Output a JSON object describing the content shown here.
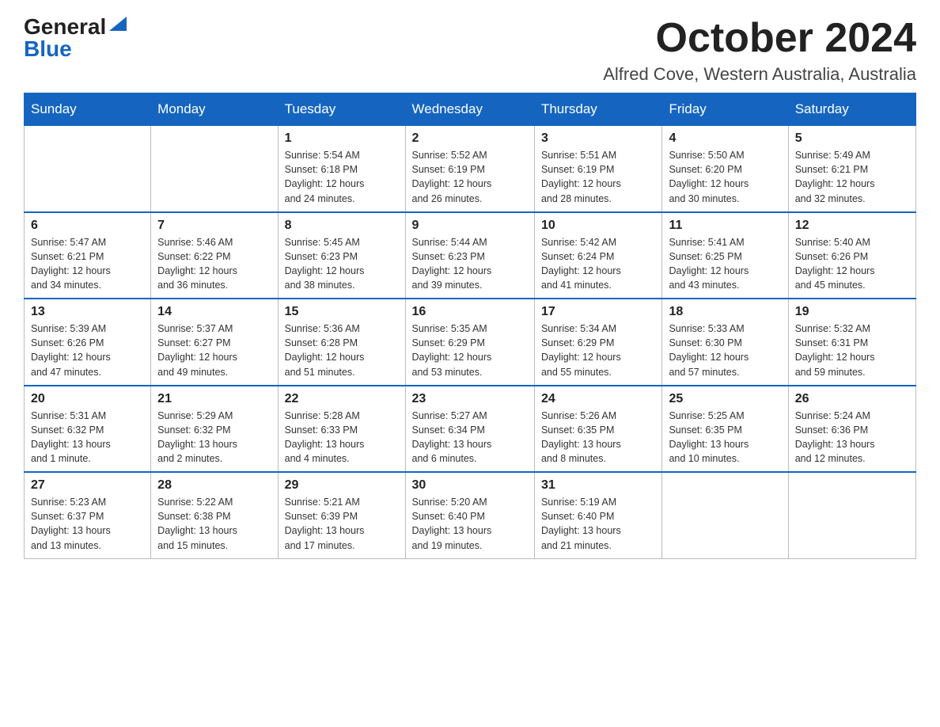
{
  "logo": {
    "general": "General",
    "blue": "Blue"
  },
  "title": "October 2024",
  "location": "Alfred Cove, Western Australia, Australia",
  "days_of_week": [
    "Sunday",
    "Monday",
    "Tuesday",
    "Wednesday",
    "Thursday",
    "Friday",
    "Saturday"
  ],
  "weeks": [
    [
      {
        "day": "",
        "info": ""
      },
      {
        "day": "",
        "info": ""
      },
      {
        "day": "1",
        "info": "Sunrise: 5:54 AM\nSunset: 6:18 PM\nDaylight: 12 hours\nand 24 minutes."
      },
      {
        "day": "2",
        "info": "Sunrise: 5:52 AM\nSunset: 6:19 PM\nDaylight: 12 hours\nand 26 minutes."
      },
      {
        "day": "3",
        "info": "Sunrise: 5:51 AM\nSunset: 6:19 PM\nDaylight: 12 hours\nand 28 minutes."
      },
      {
        "day": "4",
        "info": "Sunrise: 5:50 AM\nSunset: 6:20 PM\nDaylight: 12 hours\nand 30 minutes."
      },
      {
        "day": "5",
        "info": "Sunrise: 5:49 AM\nSunset: 6:21 PM\nDaylight: 12 hours\nand 32 minutes."
      }
    ],
    [
      {
        "day": "6",
        "info": "Sunrise: 5:47 AM\nSunset: 6:21 PM\nDaylight: 12 hours\nand 34 minutes."
      },
      {
        "day": "7",
        "info": "Sunrise: 5:46 AM\nSunset: 6:22 PM\nDaylight: 12 hours\nand 36 minutes."
      },
      {
        "day": "8",
        "info": "Sunrise: 5:45 AM\nSunset: 6:23 PM\nDaylight: 12 hours\nand 38 minutes."
      },
      {
        "day": "9",
        "info": "Sunrise: 5:44 AM\nSunset: 6:23 PM\nDaylight: 12 hours\nand 39 minutes."
      },
      {
        "day": "10",
        "info": "Sunrise: 5:42 AM\nSunset: 6:24 PM\nDaylight: 12 hours\nand 41 minutes."
      },
      {
        "day": "11",
        "info": "Sunrise: 5:41 AM\nSunset: 6:25 PM\nDaylight: 12 hours\nand 43 minutes."
      },
      {
        "day": "12",
        "info": "Sunrise: 5:40 AM\nSunset: 6:26 PM\nDaylight: 12 hours\nand 45 minutes."
      }
    ],
    [
      {
        "day": "13",
        "info": "Sunrise: 5:39 AM\nSunset: 6:26 PM\nDaylight: 12 hours\nand 47 minutes."
      },
      {
        "day": "14",
        "info": "Sunrise: 5:37 AM\nSunset: 6:27 PM\nDaylight: 12 hours\nand 49 minutes."
      },
      {
        "day": "15",
        "info": "Sunrise: 5:36 AM\nSunset: 6:28 PM\nDaylight: 12 hours\nand 51 minutes."
      },
      {
        "day": "16",
        "info": "Sunrise: 5:35 AM\nSunset: 6:29 PM\nDaylight: 12 hours\nand 53 minutes."
      },
      {
        "day": "17",
        "info": "Sunrise: 5:34 AM\nSunset: 6:29 PM\nDaylight: 12 hours\nand 55 minutes."
      },
      {
        "day": "18",
        "info": "Sunrise: 5:33 AM\nSunset: 6:30 PM\nDaylight: 12 hours\nand 57 minutes."
      },
      {
        "day": "19",
        "info": "Sunrise: 5:32 AM\nSunset: 6:31 PM\nDaylight: 12 hours\nand 59 minutes."
      }
    ],
    [
      {
        "day": "20",
        "info": "Sunrise: 5:31 AM\nSunset: 6:32 PM\nDaylight: 13 hours\nand 1 minute."
      },
      {
        "day": "21",
        "info": "Sunrise: 5:29 AM\nSunset: 6:32 PM\nDaylight: 13 hours\nand 2 minutes."
      },
      {
        "day": "22",
        "info": "Sunrise: 5:28 AM\nSunset: 6:33 PM\nDaylight: 13 hours\nand 4 minutes."
      },
      {
        "day": "23",
        "info": "Sunrise: 5:27 AM\nSunset: 6:34 PM\nDaylight: 13 hours\nand 6 minutes."
      },
      {
        "day": "24",
        "info": "Sunrise: 5:26 AM\nSunset: 6:35 PM\nDaylight: 13 hours\nand 8 minutes."
      },
      {
        "day": "25",
        "info": "Sunrise: 5:25 AM\nSunset: 6:35 PM\nDaylight: 13 hours\nand 10 minutes."
      },
      {
        "day": "26",
        "info": "Sunrise: 5:24 AM\nSunset: 6:36 PM\nDaylight: 13 hours\nand 12 minutes."
      }
    ],
    [
      {
        "day": "27",
        "info": "Sunrise: 5:23 AM\nSunset: 6:37 PM\nDaylight: 13 hours\nand 13 minutes."
      },
      {
        "day": "28",
        "info": "Sunrise: 5:22 AM\nSunset: 6:38 PM\nDaylight: 13 hours\nand 15 minutes."
      },
      {
        "day": "29",
        "info": "Sunrise: 5:21 AM\nSunset: 6:39 PM\nDaylight: 13 hours\nand 17 minutes."
      },
      {
        "day": "30",
        "info": "Sunrise: 5:20 AM\nSunset: 6:40 PM\nDaylight: 13 hours\nand 19 minutes."
      },
      {
        "day": "31",
        "info": "Sunrise: 5:19 AM\nSunset: 6:40 PM\nDaylight: 13 hours\nand 21 minutes."
      },
      {
        "day": "",
        "info": ""
      },
      {
        "day": "",
        "info": ""
      }
    ]
  ]
}
